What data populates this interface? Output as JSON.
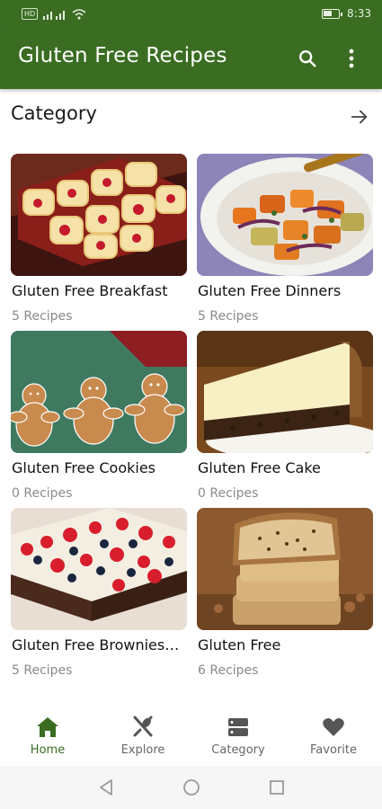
{
  "status_bar": {
    "network_badge": "HD",
    "time": "8:33",
    "battery_level": 0.6
  },
  "app_bar": {
    "title": "Gluten Free Recipes",
    "search_icon": "search-icon",
    "more_icon": "more-vertical-icon",
    "bg_color": "#3a6d22"
  },
  "section": {
    "title": "Category",
    "arrow_icon": "arrow-right-icon"
  },
  "categories": [
    {
      "title": "Gluten Free Breakfast",
      "count": "5 Recipes",
      "image": "cherry-bars-photo"
    },
    {
      "title": "Gluten Free Dinners",
      "count": "5 Recipes",
      "image": "roasted-vegetables-photo"
    },
    {
      "title": "Gluten Free Cookies",
      "count": "0 Recipes",
      "image": "gingerbread-cookies-photo"
    },
    {
      "title": "Gluten Free Cake",
      "count": "0 Recipes",
      "image": "cheesecake-slice-photo"
    },
    {
      "title": "Gluten Free Brownies…",
      "count": "5 Recipes",
      "image": "berry-brownies-photo"
    },
    {
      "title": "Gluten Free",
      "count": "6 Recipes",
      "image": "banana-bread-photo"
    }
  ],
  "bottom_nav": [
    {
      "label": "Home",
      "icon": "home-icon",
      "active": true
    },
    {
      "label": "Explore",
      "icon": "utensils-icon",
      "active": false
    },
    {
      "label": "Category",
      "icon": "category-icon",
      "active": false
    },
    {
      "label": "Favorite",
      "icon": "heart-icon",
      "active": false
    }
  ],
  "system_nav": {
    "back_icon": "back-triangle-icon",
    "home_icon": "home-circle-icon",
    "recents_icon": "recents-square-icon"
  },
  "colors": {
    "primary": "#3a6d22",
    "inactive": "#666666",
    "muted_text": "#8a8a8a"
  }
}
